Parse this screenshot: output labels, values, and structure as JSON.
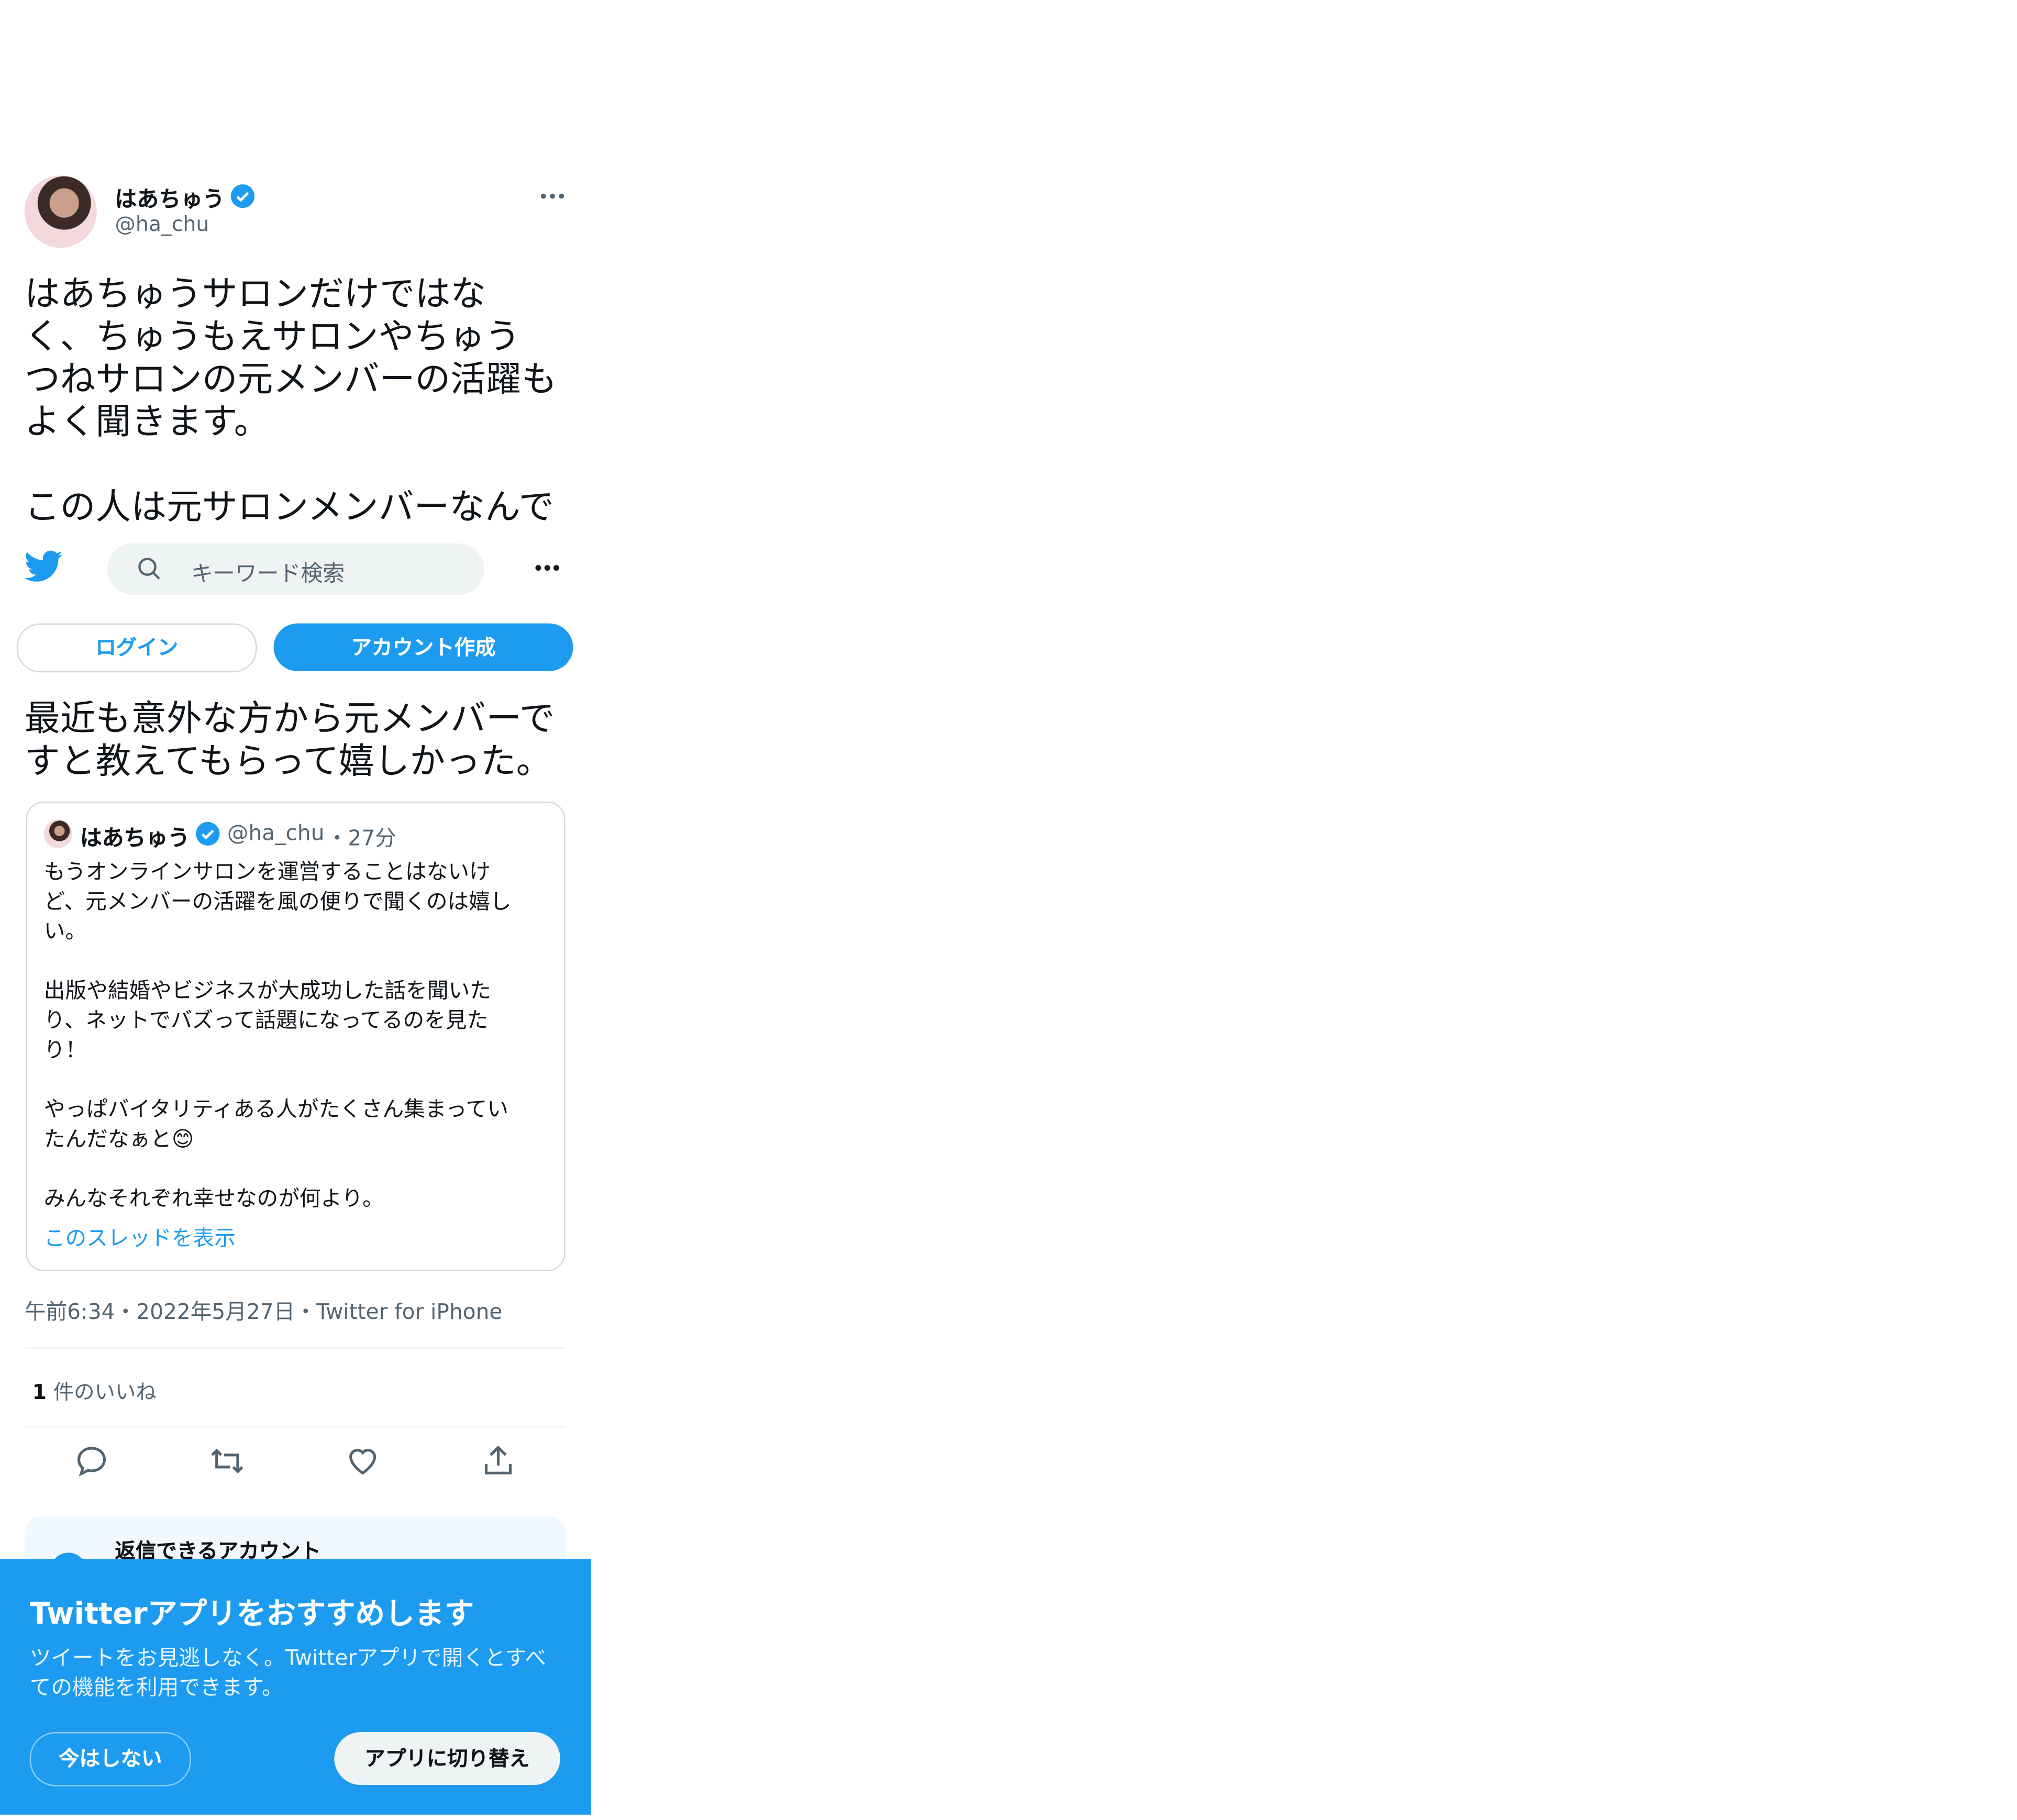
{
  "tweet": {
    "author_name": "はあちゅう",
    "author_handle": "@ha_chu",
    "text_lines": [
      "はあちゅうサロンだけではな",
      "く、ちゅうもえサロンやちゅう",
      "つねサロンの元メンバーの活躍も",
      "よく聞きます。",
      "",
      "この人は元サロンメンバーなんで"
    ],
    "text_after_lines": [
      "最近も意外な方から元メンバーで",
      "すと教えてもらって嬉しかった。"
    ],
    "timestamp": "午前6:34・2022年5月27日・Twitter for iPhone",
    "likes_count": "1",
    "likes_label": " 件のいいね"
  },
  "topbar": {
    "search_placeholder": "キーワード検索",
    "login_label": "ログイン",
    "signup_label": "アカウント作成"
  },
  "quote": {
    "author_name": "はあちゅう",
    "author_handle": "@ha_chu",
    "time": "・27分",
    "lines": [
      "もうオンラインサロンを運営することはないけ",
      "ど、元メンバーの活躍を風の便りで聞くのは嬉し",
      "い。",
      "",
      "出版や結婚やビジネスが大成功した話を聞いた",
      "り、ネットでバズって話題になってるのを見た",
      "り！",
      "",
      "やっぱバイタリティある人がたくさん集まってい",
      "たんだなぁと😊",
      "",
      "みんなそれぞれ幸せなのが何より。"
    ],
    "show_thread": "このスレッドを表示"
  },
  "reply_notice": {
    "title": "返信できるアカウント"
  },
  "app_banner": {
    "title": "Twitterアプリをおすすめします",
    "text_lines": [
      "ツイートをお見逃しなく。Twitterアプリで開くとすべ",
      "ての機能を利用できます。"
    ],
    "not_now_label": "今はしない",
    "switch_label": "アプリに切り替え"
  },
  "colors": {
    "brand": "#1d9bf0",
    "text": "#0f1419",
    "secondary": "#536471"
  },
  "icons": [
    "twitter-bird-icon",
    "search-icon",
    "more-icon",
    "verified-icon",
    "reply-icon",
    "retweet-icon",
    "like-icon",
    "share-icon"
  ]
}
